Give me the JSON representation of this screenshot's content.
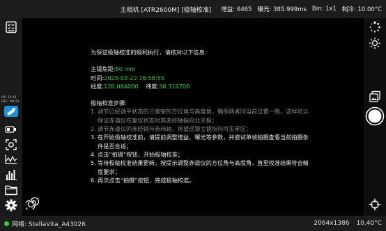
{
  "topbar": {
    "title": "主相机 [ATR2600M] [极轴校准]",
    "gain": "增益: 6465",
    "exposure": "曝光: 385.999ms",
    "bin": "Bin: 1x1",
    "cooling": "制冷: 10.00°C"
  },
  "radec": {
    "ra": "RA: 18:41",
    "dec": "DEC: 89:23"
  },
  "intro": "为保证极轴校准的顺利执行，请核对以下信息:",
  "focal": {
    "label": "主镜焦距:",
    "value": "80 mm"
  },
  "time": {
    "label": "时间:",
    "value": "2025-03-22 16:58:55"
  },
  "coords": {
    "lon_label": "经度:",
    "lon_value": "120.064000",
    "lat_label": "纬度:",
    "lat_value": "30.316700"
  },
  "steps_title": "极轴校准步骤:",
  "steps": [
    {
      "num": "1.",
      "text": "调节已经调平状态的三脚架的方位角与高度角，确保两者同当前位置一致，这样可以保证赤道仪在复位状态时其赤经轴指向北天极；"
    },
    {
      "num": "2.",
      "text": "调节赤道仪的赤经轴与赤纬轴，将望远镜主镜指向可见星区；"
    },
    {
      "num": "3.",
      "text": "在开始极轴校准前，请提前调整增益、曝光等参数，并尝试单帧拍摄查看当前拍摄条件是否合适；"
    },
    {
      "num": "4.",
      "text": "点击“拍摄”按钮，开始极轴校准；"
    },
    {
      "num": "5.",
      "text": "等待极轴校准结果更新，按提示调整赤道仪的方位角与高度角，直至校准结果符合精度要求；"
    },
    {
      "num": "6.",
      "text": "再次点击“拍摄”按钮，完成极轴校准。"
    }
  ],
  "bottombar": {
    "network": "网络: StellaVita_A43026",
    "resolution": "2064x1386",
    "temperature": "10.40°C"
  },
  "colors": {
    "accent_green": "#2ecc40",
    "background": "#000000",
    "bar": "#1c1c1c"
  }
}
